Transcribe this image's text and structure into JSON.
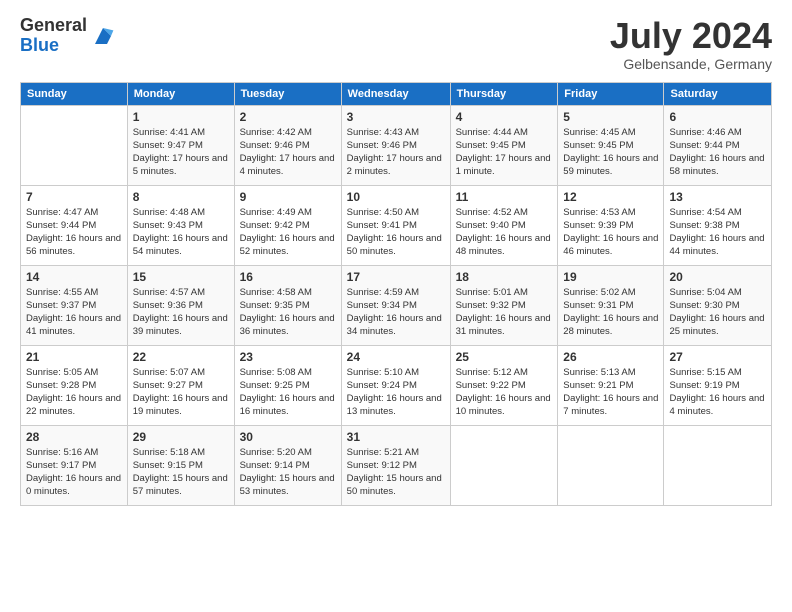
{
  "logo": {
    "general": "General",
    "blue": "Blue"
  },
  "title": "July 2024",
  "location": "Gelbensande, Germany",
  "days_of_week": [
    "Sunday",
    "Monday",
    "Tuesday",
    "Wednesday",
    "Thursday",
    "Friday",
    "Saturday"
  ],
  "weeks": [
    [
      {
        "day": "",
        "sunrise": "",
        "sunset": "",
        "daylight": ""
      },
      {
        "day": "1",
        "sunrise": "Sunrise: 4:41 AM",
        "sunset": "Sunset: 9:47 PM",
        "daylight": "Daylight: 17 hours and 5 minutes."
      },
      {
        "day": "2",
        "sunrise": "Sunrise: 4:42 AM",
        "sunset": "Sunset: 9:46 PM",
        "daylight": "Daylight: 17 hours and 4 minutes."
      },
      {
        "day": "3",
        "sunrise": "Sunrise: 4:43 AM",
        "sunset": "Sunset: 9:46 PM",
        "daylight": "Daylight: 17 hours and 2 minutes."
      },
      {
        "day": "4",
        "sunrise": "Sunrise: 4:44 AM",
        "sunset": "Sunset: 9:45 PM",
        "daylight": "Daylight: 17 hours and 1 minute."
      },
      {
        "day": "5",
        "sunrise": "Sunrise: 4:45 AM",
        "sunset": "Sunset: 9:45 PM",
        "daylight": "Daylight: 16 hours and 59 minutes."
      },
      {
        "day": "6",
        "sunrise": "Sunrise: 4:46 AM",
        "sunset": "Sunset: 9:44 PM",
        "daylight": "Daylight: 16 hours and 58 minutes."
      }
    ],
    [
      {
        "day": "7",
        "sunrise": "Sunrise: 4:47 AM",
        "sunset": "Sunset: 9:44 PM",
        "daylight": "Daylight: 16 hours and 56 minutes."
      },
      {
        "day": "8",
        "sunrise": "Sunrise: 4:48 AM",
        "sunset": "Sunset: 9:43 PM",
        "daylight": "Daylight: 16 hours and 54 minutes."
      },
      {
        "day": "9",
        "sunrise": "Sunrise: 4:49 AM",
        "sunset": "Sunset: 9:42 PM",
        "daylight": "Daylight: 16 hours and 52 minutes."
      },
      {
        "day": "10",
        "sunrise": "Sunrise: 4:50 AM",
        "sunset": "Sunset: 9:41 PM",
        "daylight": "Daylight: 16 hours and 50 minutes."
      },
      {
        "day": "11",
        "sunrise": "Sunrise: 4:52 AM",
        "sunset": "Sunset: 9:40 PM",
        "daylight": "Daylight: 16 hours and 48 minutes."
      },
      {
        "day": "12",
        "sunrise": "Sunrise: 4:53 AM",
        "sunset": "Sunset: 9:39 PM",
        "daylight": "Daylight: 16 hours and 46 minutes."
      },
      {
        "day": "13",
        "sunrise": "Sunrise: 4:54 AM",
        "sunset": "Sunset: 9:38 PM",
        "daylight": "Daylight: 16 hours and 44 minutes."
      }
    ],
    [
      {
        "day": "14",
        "sunrise": "Sunrise: 4:55 AM",
        "sunset": "Sunset: 9:37 PM",
        "daylight": "Daylight: 16 hours and 41 minutes."
      },
      {
        "day": "15",
        "sunrise": "Sunrise: 4:57 AM",
        "sunset": "Sunset: 9:36 PM",
        "daylight": "Daylight: 16 hours and 39 minutes."
      },
      {
        "day": "16",
        "sunrise": "Sunrise: 4:58 AM",
        "sunset": "Sunset: 9:35 PM",
        "daylight": "Daylight: 16 hours and 36 minutes."
      },
      {
        "day": "17",
        "sunrise": "Sunrise: 4:59 AM",
        "sunset": "Sunset: 9:34 PM",
        "daylight": "Daylight: 16 hours and 34 minutes."
      },
      {
        "day": "18",
        "sunrise": "Sunrise: 5:01 AM",
        "sunset": "Sunset: 9:32 PM",
        "daylight": "Daylight: 16 hours and 31 minutes."
      },
      {
        "day": "19",
        "sunrise": "Sunrise: 5:02 AM",
        "sunset": "Sunset: 9:31 PM",
        "daylight": "Daylight: 16 hours and 28 minutes."
      },
      {
        "day": "20",
        "sunrise": "Sunrise: 5:04 AM",
        "sunset": "Sunset: 9:30 PM",
        "daylight": "Daylight: 16 hours and 25 minutes."
      }
    ],
    [
      {
        "day": "21",
        "sunrise": "Sunrise: 5:05 AM",
        "sunset": "Sunset: 9:28 PM",
        "daylight": "Daylight: 16 hours and 22 minutes."
      },
      {
        "day": "22",
        "sunrise": "Sunrise: 5:07 AM",
        "sunset": "Sunset: 9:27 PM",
        "daylight": "Daylight: 16 hours and 19 minutes."
      },
      {
        "day": "23",
        "sunrise": "Sunrise: 5:08 AM",
        "sunset": "Sunset: 9:25 PM",
        "daylight": "Daylight: 16 hours and 16 minutes."
      },
      {
        "day": "24",
        "sunrise": "Sunrise: 5:10 AM",
        "sunset": "Sunset: 9:24 PM",
        "daylight": "Daylight: 16 hours and 13 minutes."
      },
      {
        "day": "25",
        "sunrise": "Sunrise: 5:12 AM",
        "sunset": "Sunset: 9:22 PM",
        "daylight": "Daylight: 16 hours and 10 minutes."
      },
      {
        "day": "26",
        "sunrise": "Sunrise: 5:13 AM",
        "sunset": "Sunset: 9:21 PM",
        "daylight": "Daylight: 16 hours and 7 minutes."
      },
      {
        "day": "27",
        "sunrise": "Sunrise: 5:15 AM",
        "sunset": "Sunset: 9:19 PM",
        "daylight": "Daylight: 16 hours and 4 minutes."
      }
    ],
    [
      {
        "day": "28",
        "sunrise": "Sunrise: 5:16 AM",
        "sunset": "Sunset: 9:17 PM",
        "daylight": "Daylight: 16 hours and 0 minutes."
      },
      {
        "day": "29",
        "sunrise": "Sunrise: 5:18 AM",
        "sunset": "Sunset: 9:15 PM",
        "daylight": "Daylight: 15 hours and 57 minutes."
      },
      {
        "day": "30",
        "sunrise": "Sunrise: 5:20 AM",
        "sunset": "Sunset: 9:14 PM",
        "daylight": "Daylight: 15 hours and 53 minutes."
      },
      {
        "day": "31",
        "sunrise": "Sunrise: 5:21 AM",
        "sunset": "Sunset: 9:12 PM",
        "daylight": "Daylight: 15 hours and 50 minutes."
      },
      {
        "day": "",
        "sunrise": "",
        "sunset": "",
        "daylight": ""
      },
      {
        "day": "",
        "sunrise": "",
        "sunset": "",
        "daylight": ""
      },
      {
        "day": "",
        "sunrise": "",
        "sunset": "",
        "daylight": ""
      }
    ]
  ]
}
